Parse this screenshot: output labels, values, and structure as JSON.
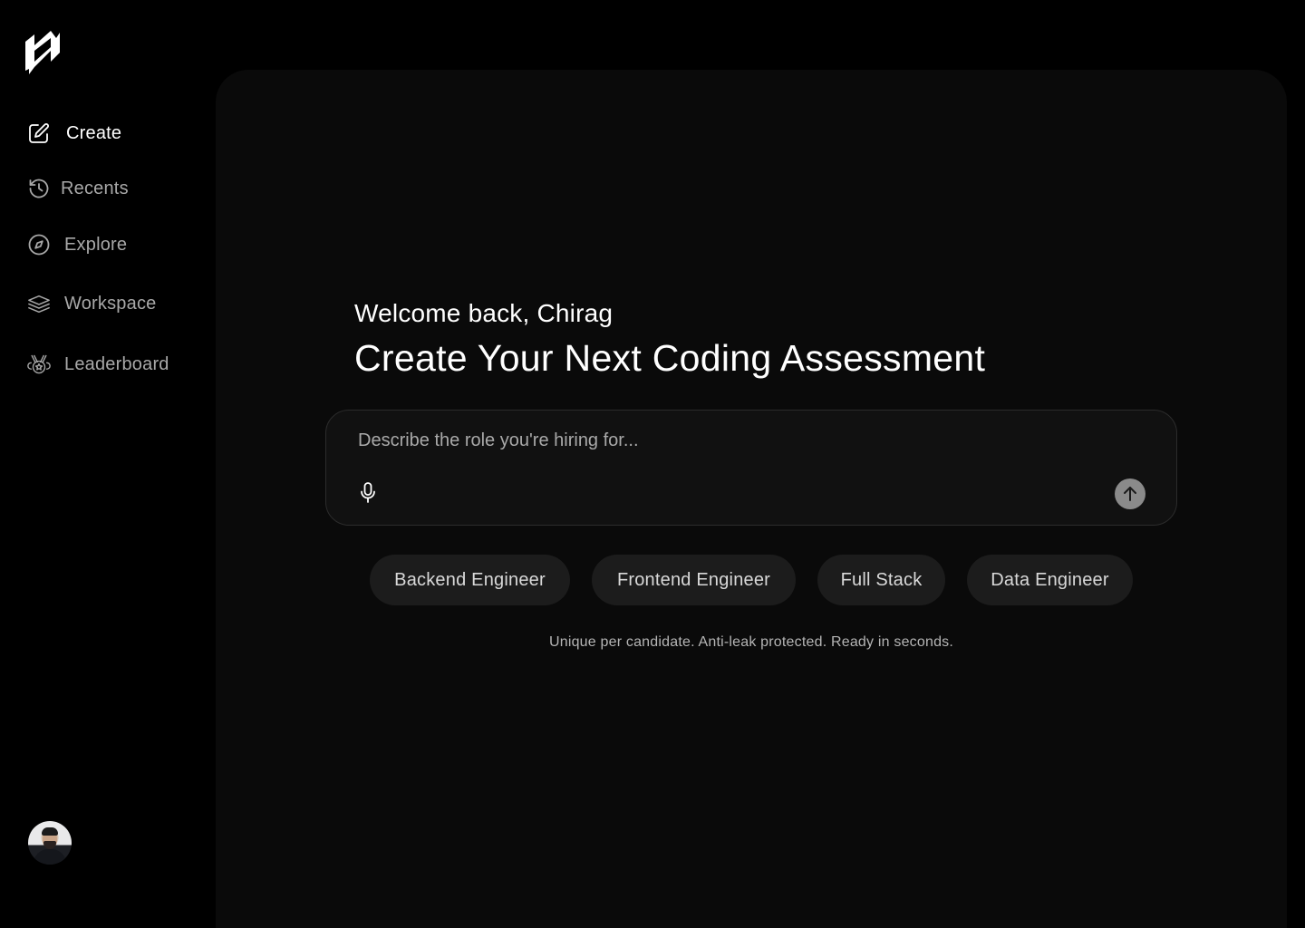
{
  "sidebar": {
    "logo_icon": "brand-logo",
    "items": [
      {
        "label": "Create",
        "icon": "edit-icon",
        "active": true
      },
      {
        "label": "Recents",
        "icon": "history-icon",
        "active": false
      },
      {
        "label": "Explore",
        "icon": "compass-icon",
        "active": false
      },
      {
        "label": "Workspace",
        "icon": "layers-icon",
        "active": false
      },
      {
        "label": "Leaderboard",
        "icon": "medal-icon",
        "active": false
      }
    ],
    "avatar_icon": "user-avatar"
  },
  "main": {
    "welcome": "Welcome back, Chirag",
    "headline": "Create Your Next Coding Assessment",
    "prompt": {
      "placeholder": "Describe the role you're hiring for...",
      "value": "",
      "mic_icon": "microphone-icon",
      "send_icon": "arrow-up-icon"
    },
    "chips": [
      "Backend Engineer",
      "Frontend Engineer",
      "Full Stack",
      "Data Engineer"
    ],
    "footnote": "Unique per candidate. Anti-leak protected. Ready in seconds."
  },
  "colors": {
    "background": "#000000",
    "panel": "#0a0a0a",
    "input_bg": "#111111",
    "chip_bg": "#1c1c1c",
    "muted_text": "#a8a8a8",
    "send_button": "#8a8a8a"
  }
}
